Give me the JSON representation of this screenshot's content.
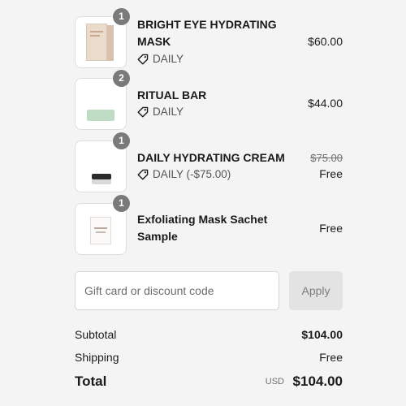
{
  "items": [
    {
      "quantity": "1",
      "name": "BRIGHT EYE HYDRATING MASK",
      "tag": "DAILY",
      "price": "$60.00",
      "image": "mask-box"
    },
    {
      "quantity": "2",
      "name": "RITUAL BAR",
      "tag": "DAILY",
      "price": "$44.00",
      "image": "soap-bar"
    },
    {
      "quantity": "1",
      "name": "DAILY HYDRATING CREAM",
      "tag": "DAILY (-$75.00)",
      "original_price": "$75.00",
      "price": "Free",
      "image": "cream-jar"
    },
    {
      "quantity": "1",
      "name": "Exfoliating Mask Sachet Sample",
      "price": "Free",
      "image": "sachet"
    }
  ],
  "discount": {
    "placeholder": "Gift card or discount code",
    "value": "",
    "apply_label": "Apply"
  },
  "summary": {
    "subtotal_label": "Subtotal",
    "subtotal_value": "$104.00",
    "shipping_label": "Shipping",
    "shipping_value": "Free",
    "total_label": "Total",
    "currency": "USD",
    "total_value": "$104.00"
  },
  "colors": {
    "background": "#f4f4f4",
    "quantity_badge": "#7a7a7a",
    "apply_button": "#e3e3e3"
  },
  "icons": {
    "tag": "tag-icon"
  }
}
